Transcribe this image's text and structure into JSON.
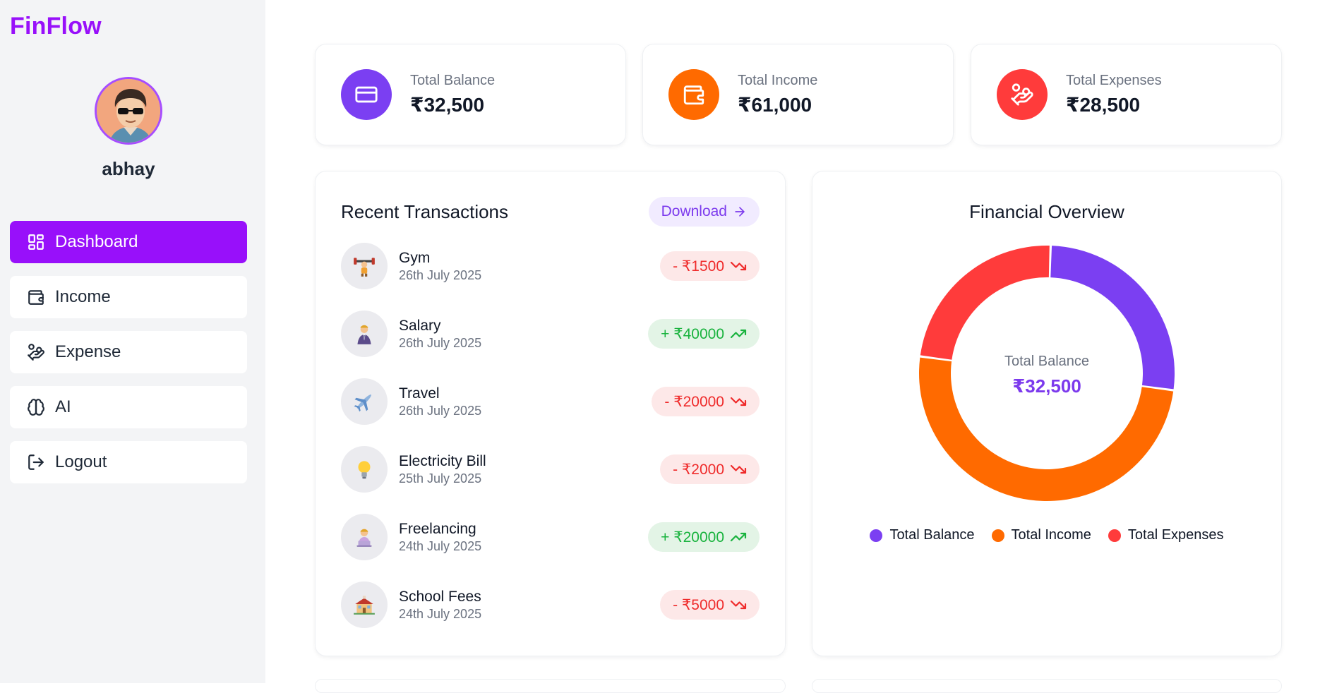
{
  "app": {
    "brand": "FinFlow"
  },
  "user": {
    "name": "abhay"
  },
  "sidebar": {
    "items": [
      {
        "label": "Dashboard",
        "icon": "dashboard-icon",
        "active": true
      },
      {
        "label": "Income",
        "icon": "wallet-icon",
        "active": false
      },
      {
        "label": "Expense",
        "icon": "hand-coins-icon",
        "active": false
      },
      {
        "label": "AI",
        "icon": "brain-icon",
        "active": false
      },
      {
        "label": "Logout",
        "icon": "logout-icon",
        "active": false
      }
    ]
  },
  "stats": [
    {
      "label": "Total Balance",
      "value": "₹32,500",
      "icon": "card-icon",
      "color": "#7b3ff2"
    },
    {
      "label": "Total Income",
      "value": "₹61,000",
      "icon": "wallet-icon",
      "color": "#ff6a00"
    },
    {
      "label": "Total Expenses",
      "value": "₹28,500",
      "icon": "hand-coins-icon",
      "color": "#ff3b3b"
    }
  ],
  "transactions": {
    "title": "Recent Transactions",
    "download_label": "Download",
    "items": [
      {
        "name": "Gym",
        "date": "26th July 2025",
        "amount": "- ₹1500",
        "type": "expense",
        "icon": "weightlifter-icon"
      },
      {
        "name": "Salary",
        "date": "26th July 2025",
        "amount": "+ ₹40000",
        "type": "income",
        "icon": "businessman-icon"
      },
      {
        "name": "Travel",
        "date": "26th July 2025",
        "amount": "- ₹20000",
        "type": "expense",
        "icon": "airplane-icon"
      },
      {
        "name": "Electricity Bill",
        "date": "25th July 2025",
        "amount": "- ₹2000",
        "type": "expense",
        "icon": "lightbulb-icon"
      },
      {
        "name": "Freelancing",
        "date": "24th July 2025",
        "amount": "+ ₹20000",
        "type": "income",
        "icon": "laptop-worker-icon"
      },
      {
        "name": "School Fees",
        "date": "24th July 2025",
        "amount": "- ₹5000",
        "type": "expense",
        "icon": "school-icon"
      }
    ]
  },
  "overview": {
    "title": "Financial Overview",
    "center_label": "Total Balance",
    "center_value": "₹32,500"
  },
  "chart_data": {
    "type": "pie",
    "title": "Financial Overview",
    "categories": [
      "Total Balance",
      "Total Income",
      "Total Expenses"
    ],
    "values": [
      32500,
      61000,
      28500
    ],
    "colors": [
      "#7b3ff2",
      "#ff6a00",
      "#ff3b3b"
    ],
    "legend": "bottom"
  }
}
